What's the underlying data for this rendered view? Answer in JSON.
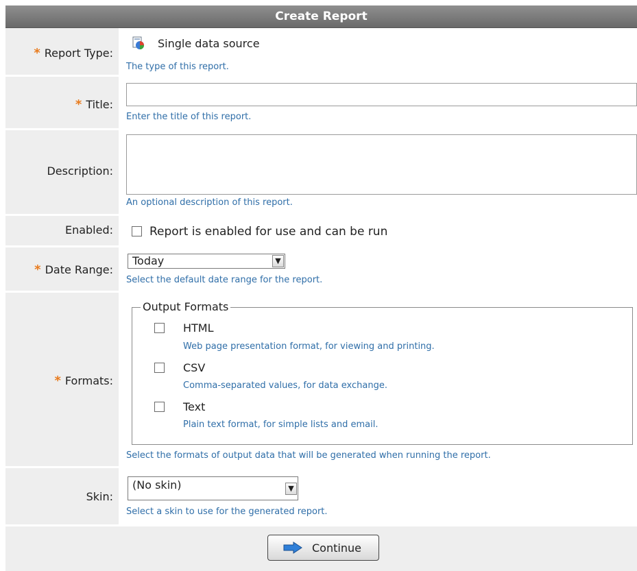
{
  "header": {
    "title": "Create Report"
  },
  "report_type": {
    "label": "Report Type:",
    "value": "Single data source",
    "hint": "The type of this report.",
    "icon": "report-pie-chart-icon"
  },
  "title_field": {
    "label": "Title:",
    "value": "",
    "hint": "Enter the title of this report."
  },
  "description_field": {
    "label": "Description:",
    "value": "",
    "hint": "An optional description of this report."
  },
  "enabled": {
    "label": "Enabled:",
    "checkbox_label": "Report is enabled for use and can be run",
    "checked": false
  },
  "date_range": {
    "label": "Date Range:",
    "selected": "Today",
    "hint": "Select the default date range for the report."
  },
  "formats": {
    "label": "Formats:",
    "legend": "Output Formats",
    "options": [
      {
        "name": "HTML",
        "desc": "Web page presentation format, for viewing and printing.",
        "checked": false
      },
      {
        "name": "CSV",
        "desc": "Comma-separated values, for data exchange.",
        "checked": false
      },
      {
        "name": "Text",
        "desc": "Plain text format, for simple lists and email.",
        "checked": false
      }
    ],
    "hint": "Select the formats of output data that will be generated when running the report."
  },
  "skin": {
    "label": "Skin:",
    "selected": "(No skin)",
    "hint": "Select a skin to use for the generated report."
  },
  "footer": {
    "continue_label": "Continue",
    "continue_icon": "arrow-right-icon"
  },
  "colors": {
    "required_star": "#e87a1c",
    "hint_text": "#2f6ea8",
    "header_bg": "#7a7a7a",
    "label_bg": "#eeeeee"
  }
}
